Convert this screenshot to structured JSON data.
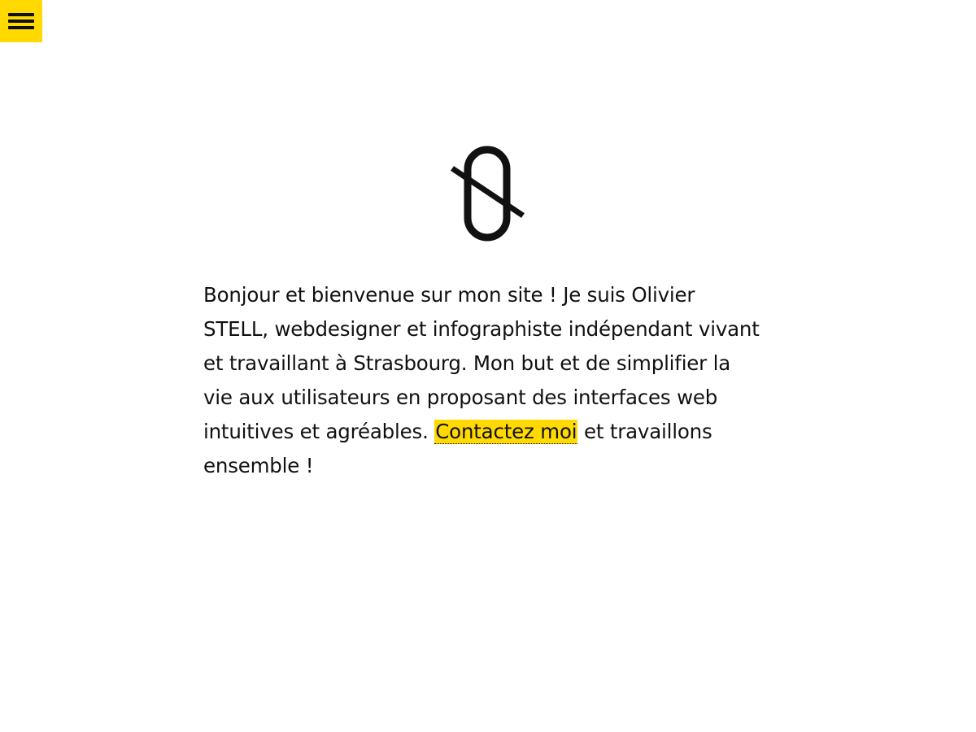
{
  "menu": {
    "icon": "hamburger-menu-icon",
    "color": "#FFD900"
  },
  "logo": {
    "icon": "slashed-zero-monogram-logo"
  },
  "intro": {
    "text_before": "Bonjour et bienvenue sur mon site ! Je suis Olivier STELL, webdesigner et infographiste indépendant vivant et travaillant à Strasbourg. Mon but et de simplifier la vie aux utilisateurs en proposant des interfaces web intuitives et agréables.",
    "contact_link_label": "Contactez moi",
    "text_after": "et travaillons ensemble !"
  },
  "colors": {
    "accent": "#FFD900",
    "text": "#111111",
    "background": "#FFFFFF"
  }
}
